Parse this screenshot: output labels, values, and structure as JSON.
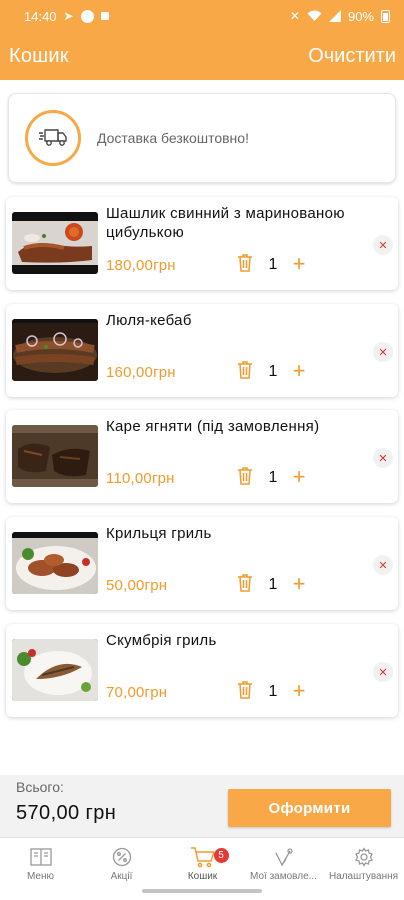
{
  "status_bar": {
    "time": "14:40",
    "battery": "90%"
  },
  "header": {
    "title": "Кошик",
    "clear_label": "Очистити"
  },
  "delivery": {
    "text": "Доставка безкоштовно!"
  },
  "cart": {
    "items": [
      {
        "name": "Шашлик свинний з маринованою цибулькою",
        "price": "180,00грн",
        "qty": "1"
      },
      {
        "name": "Люля-кебаб",
        "price": "160,00грн",
        "qty": "1"
      },
      {
        "name": "Каре ягняти (під замовлення)",
        "price": "110,00грн",
        "qty": "1"
      },
      {
        "name": "Крильця гриль",
        "price": "50,00грн",
        "qty": "1"
      },
      {
        "name": "Скумбрія гриль",
        "price": "70,00грн",
        "qty": "1"
      }
    ]
  },
  "footer": {
    "total_label": "Всього:",
    "total_value": "570,00 грн",
    "checkout_label": "Оформити"
  },
  "nav": {
    "items": [
      {
        "label": "Меню",
        "icon": "menu-book-icon"
      },
      {
        "label": "Акції",
        "icon": "percent-icon"
      },
      {
        "label": "Кошик",
        "icon": "cart-icon",
        "badge": "5"
      },
      {
        "label": "Мої замовле...",
        "icon": "orders-icon"
      },
      {
        "label": "Налаштування",
        "icon": "gear-icon"
      }
    ]
  },
  "colors": {
    "accent": "#f9a848",
    "price": "#f39a2b",
    "remove": "#d9342b",
    "badge": "#e53935"
  }
}
